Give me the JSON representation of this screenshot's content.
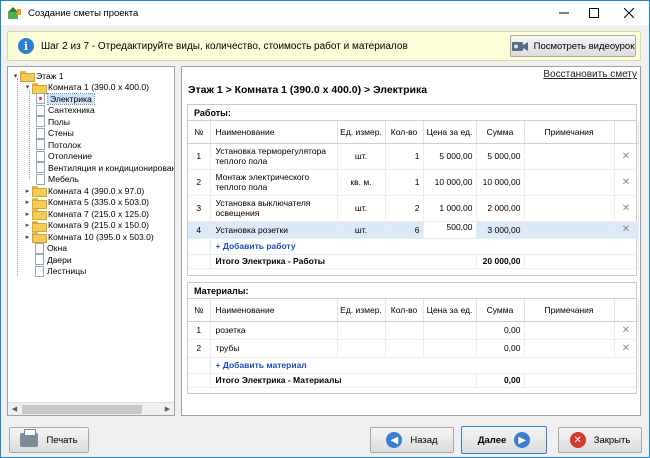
{
  "window": {
    "title": "Создание сметы проекта",
    "controls": [
      "minimize-icon",
      "maximize-icon",
      "close-icon"
    ]
  },
  "banner": {
    "text": "Шаг 2 из 7 - Отредактируйте виды, количество, стоимость работ и материалов",
    "video_button": "Посмотреть видеоурок"
  },
  "tree": {
    "items": [
      {
        "label": "Этаж 1",
        "level": 0,
        "icon": "folder",
        "expander": "minus"
      },
      {
        "label": "Комната 1 (390.0 x 400.0)",
        "level": 1,
        "icon": "folder",
        "expander": "minus"
      },
      {
        "label": "Электрика",
        "level": 2,
        "icon": "doc-red",
        "selected": true
      },
      {
        "label": "Сантехника",
        "level": 2,
        "icon": "doc"
      },
      {
        "label": "Полы",
        "level": 2,
        "icon": "doc"
      },
      {
        "label": "Стены",
        "level": 2,
        "icon": "doc"
      },
      {
        "label": "Потолок",
        "level": 2,
        "icon": "doc"
      },
      {
        "label": "Отопление",
        "level": 2,
        "icon": "doc"
      },
      {
        "label": "Вентиляция и кондиционирование",
        "level": 2,
        "icon": "doc"
      },
      {
        "label": "Мебель",
        "level": 2,
        "icon": "doc"
      },
      {
        "label": "Комната 4 (390.0 x 97.0)",
        "level": 1,
        "icon": "folder",
        "expander": "plus"
      },
      {
        "label": "Комната 5 (335.0 x 503.0)",
        "level": 1,
        "icon": "folder",
        "expander": "plus"
      },
      {
        "label": "Комната 7 (215.0 x 125.0)",
        "level": 1,
        "icon": "folder",
        "expander": "plus"
      },
      {
        "label": "Комната 9 (215.0 x 150.0)",
        "level": 1,
        "icon": "folder",
        "expander": "plus"
      },
      {
        "label": "Комната 10 (395.0 x 503.0)",
        "level": 1,
        "icon": "folder",
        "expander": "plus"
      },
      {
        "label": "Окна",
        "level": 1,
        "icon": "doc"
      },
      {
        "label": "Двери",
        "level": 1,
        "icon": "doc"
      },
      {
        "label": "Лестницы",
        "level": 1,
        "icon": "doc"
      }
    ]
  },
  "main": {
    "restore_link": "Восстановить смету",
    "breadcrumb": "Этаж 1 > Комната 1 (390.0 x 400.0) > Электрика",
    "works": {
      "title": "Работы:",
      "columns": [
        "№",
        "Наименование",
        "Ед. измер.",
        "Кол-во",
        "Цена за ед.",
        "Сумма",
        "Примечания"
      ],
      "rows": [
        {
          "n": "1",
          "name": "Установка терморегулятора теплого пола",
          "unit": "шт.",
          "qty": "1",
          "price": "5 000,00",
          "sum": "5 000,00",
          "note": ""
        },
        {
          "n": "2",
          "name": "Монтаж электрического теплого пола",
          "unit": "кв. м.",
          "qty": "1",
          "price": "10 000,00",
          "sum": "10 000,00",
          "note": ""
        },
        {
          "n": "3",
          "name": "Установка выключателя освещения",
          "unit": "шт.",
          "qty": "2",
          "price": "1 000,00",
          "sum": "2 000,00",
          "note": ""
        },
        {
          "n": "4",
          "name": "Установка розетки",
          "unit": "шт.",
          "qty": "6",
          "price": "500,00",
          "sum": "3 000,00",
          "note": ""
        }
      ],
      "add_link": "+ Добавить работу",
      "total_label": "Итого Электрика - Работы",
      "total_value": "20 000,00"
    },
    "materials": {
      "title": "Материалы:",
      "columns": [
        "№",
        "Наименование",
        "Ед. измер.",
        "Кол-во",
        "Цена за ед.",
        "Сумма",
        "Примечания"
      ],
      "rows": [
        {
          "n": "1",
          "name": "розетка",
          "unit": "",
          "qty": "",
          "price": "",
          "sum": "0,00",
          "note": ""
        },
        {
          "n": "2",
          "name": "трубы",
          "unit": "",
          "qty": "",
          "price": "",
          "sum": "0,00",
          "note": ""
        }
      ],
      "add_link": "+ Добавить материал",
      "total_label": "Итого Электрика - Материалы",
      "total_value": "0,00"
    }
  },
  "footer": {
    "print": "Печать",
    "back": "Назад",
    "next": "Далее",
    "close": "Закрыть"
  }
}
